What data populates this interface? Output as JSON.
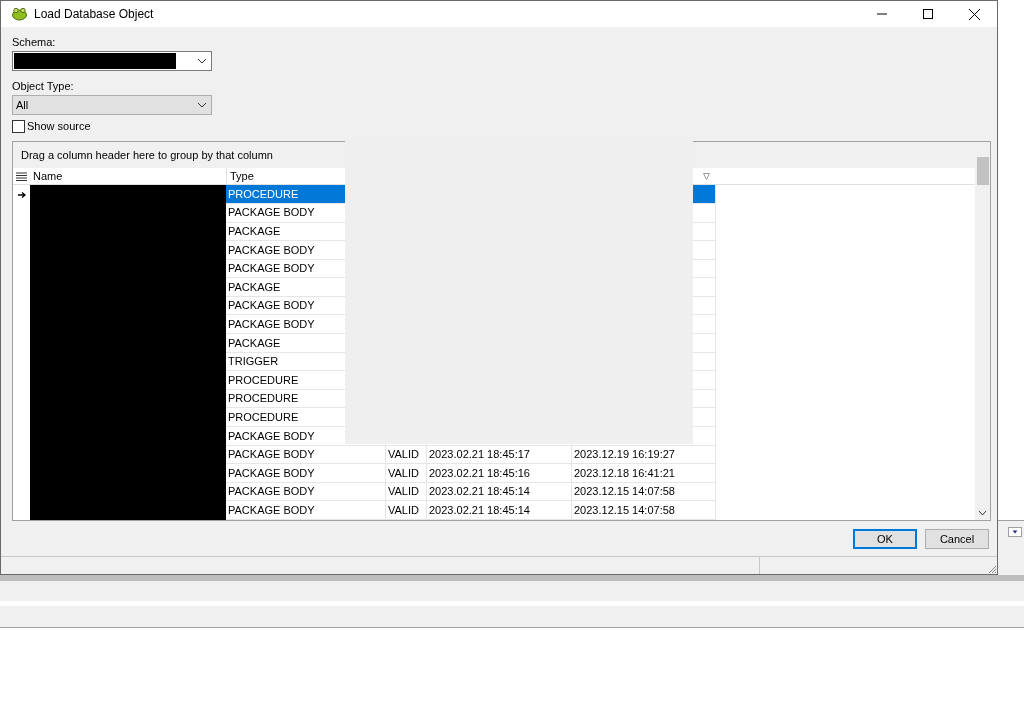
{
  "window": {
    "title": "Load Database Object"
  },
  "schema": {
    "label": "Schema:"
  },
  "object_type": {
    "label": "Object Type:",
    "value": "All"
  },
  "show_source": {
    "label": "Show source",
    "checked": false
  },
  "grid": {
    "group_hint": "Drag a column header here to group by that column",
    "columns": [
      {
        "label": "Name"
      },
      {
        "label": "Type"
      }
    ],
    "rows": [
      {
        "type": "PROCEDURE",
        "selected": true
      },
      {
        "type": "PACKAGE BODY",
        "selected": false
      },
      {
        "type": "PACKAGE",
        "selected": false
      },
      {
        "type": "PACKAGE BODY",
        "selected": false
      },
      {
        "type": "PACKAGE BODY",
        "selected": false
      },
      {
        "type": "PACKAGE",
        "selected": false
      },
      {
        "type": "PACKAGE BODY",
        "selected": false
      },
      {
        "type": "PACKAGE BODY",
        "selected": false
      },
      {
        "type": "PACKAGE",
        "selected": false
      },
      {
        "type": "TRIGGER",
        "selected": false
      },
      {
        "type": "PROCEDURE",
        "selected": false
      },
      {
        "type": "PROCEDURE",
        "selected": false
      },
      {
        "type": "PROCEDURE",
        "selected": false
      },
      {
        "type": "PACKAGE BODY",
        "selected": false
      },
      {
        "type": "PACKAGE BODY",
        "status": "VALID",
        "created": "2023.02.21 18:45:17",
        "modified": "2023.12.19 16:19:27",
        "selected": false
      },
      {
        "type": "PACKAGE BODY",
        "status": "VALID",
        "created": "2023.02.21 18:45:16",
        "modified": "2023.12.18 16:41:21",
        "selected": false
      },
      {
        "type": "PACKAGE BODY",
        "status": "VALID",
        "created": "2023.02.21 18:45:14",
        "modified": "2023.12.15 14:07:58",
        "selected": false
      },
      {
        "type": "PACKAGE BODY",
        "status": "VALID",
        "created": "2023.02.21 18:45:14",
        "modified": "2023.12.15 14:07:58",
        "selected": false
      }
    ]
  },
  "buttons": [
    {
      "label": "OK",
      "default": true
    },
    {
      "label": "Cancel",
      "default": false
    }
  ]
}
